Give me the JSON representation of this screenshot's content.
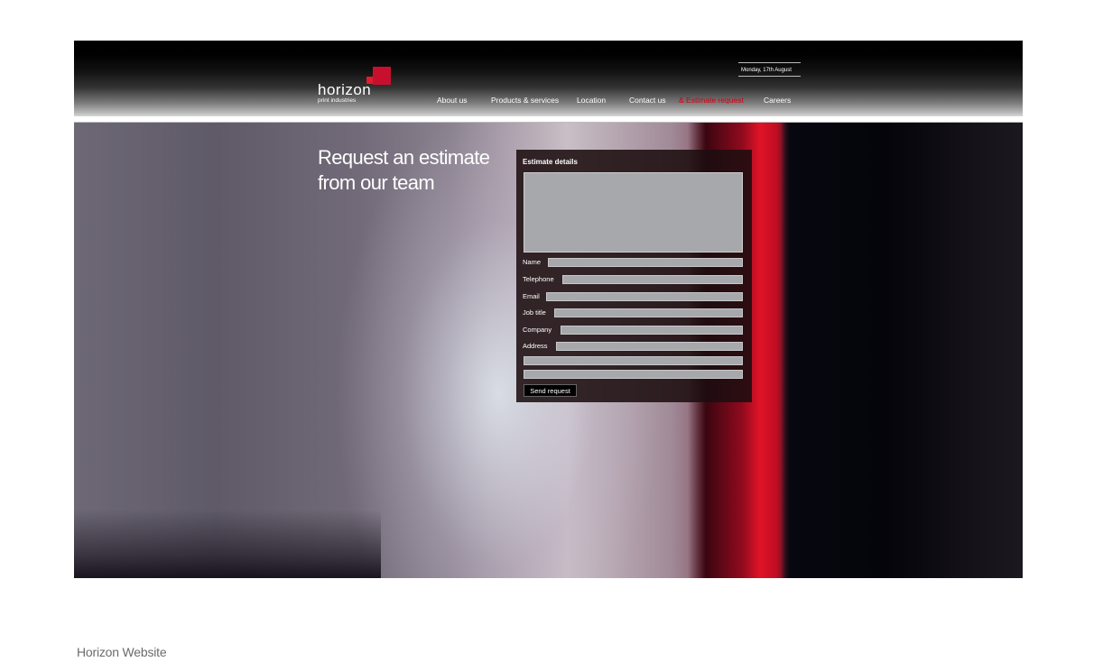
{
  "site": {
    "logo": {
      "wordmark": "horizon",
      "tagline": "print industries"
    },
    "date": "Monday, 17th August",
    "nav": [
      {
        "label": "About us"
      },
      {
        "label": "Products & services"
      },
      {
        "label": "Location"
      },
      {
        "label": "Contact us"
      },
      {
        "label": "& Estimate request",
        "active": true
      },
      {
        "label": "Careers"
      }
    ],
    "accent_color": "#d40015"
  },
  "hero": {
    "title_line1": "Request an estimate",
    "title_line2": "from our team"
  },
  "form": {
    "legend": "Estimate details",
    "fields": {
      "name": "Name",
      "telephone": "Telephone",
      "email": "Email",
      "job_title": "Job title",
      "company": "Company",
      "address": "Address"
    },
    "submit_label": "Send request"
  },
  "caption": "Horizon Website"
}
